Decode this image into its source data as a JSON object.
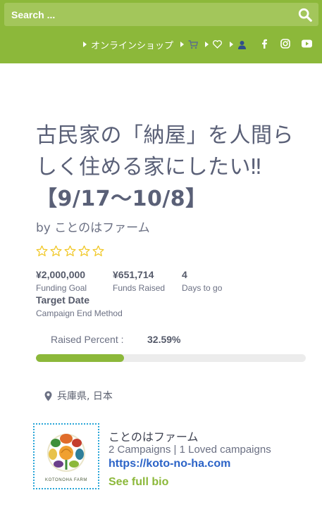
{
  "search": {
    "placeholder": "Search ..."
  },
  "nav": {
    "shop_label": "オンラインショップ",
    "cart_icon": "cart-icon",
    "wishlist_icon": "heart-icon",
    "account_icon": "user-icon",
    "social": [
      "facebook-icon",
      "instagram-icon",
      "youtube-icon"
    ]
  },
  "campaign": {
    "title_lines": [
      "古民家の「納屋」を人間ら",
      "しく住める家にしたい‼",
      "【9/17〜10/8】"
    ],
    "byline": "by ことのはファーム",
    "rating": {
      "stars_filled": 0,
      "stars_total": 5
    },
    "stats": {
      "goal_value": "¥2,000,000",
      "goal_label": "Funding Goal",
      "raised_value": "¥651,714",
      "raised_label": "Funds Raised",
      "days_value": "4",
      "days_label": "Days to go",
      "end_method_value": "Target Date",
      "end_method_label": "Campaign End Method"
    },
    "raised_percent_label": "Raised Percent :",
    "raised_percent_value": "32.59%",
    "progress_fraction": 0.3259,
    "location": "兵庫県, 日本"
  },
  "author": {
    "logo_text": "KOTONOHA FARM",
    "name": "ことのはファーム",
    "meta": "2 Campaigns | 1 Loved campaigns",
    "website": "https://koto-no-ha.com",
    "bio_link": "See full bio"
  },
  "colors": {
    "brand_green": "#8cb83a",
    "link_blue": "#2b63c7",
    "star_yellow": "#f0c419",
    "logo_border": "#2aa6d8"
  }
}
